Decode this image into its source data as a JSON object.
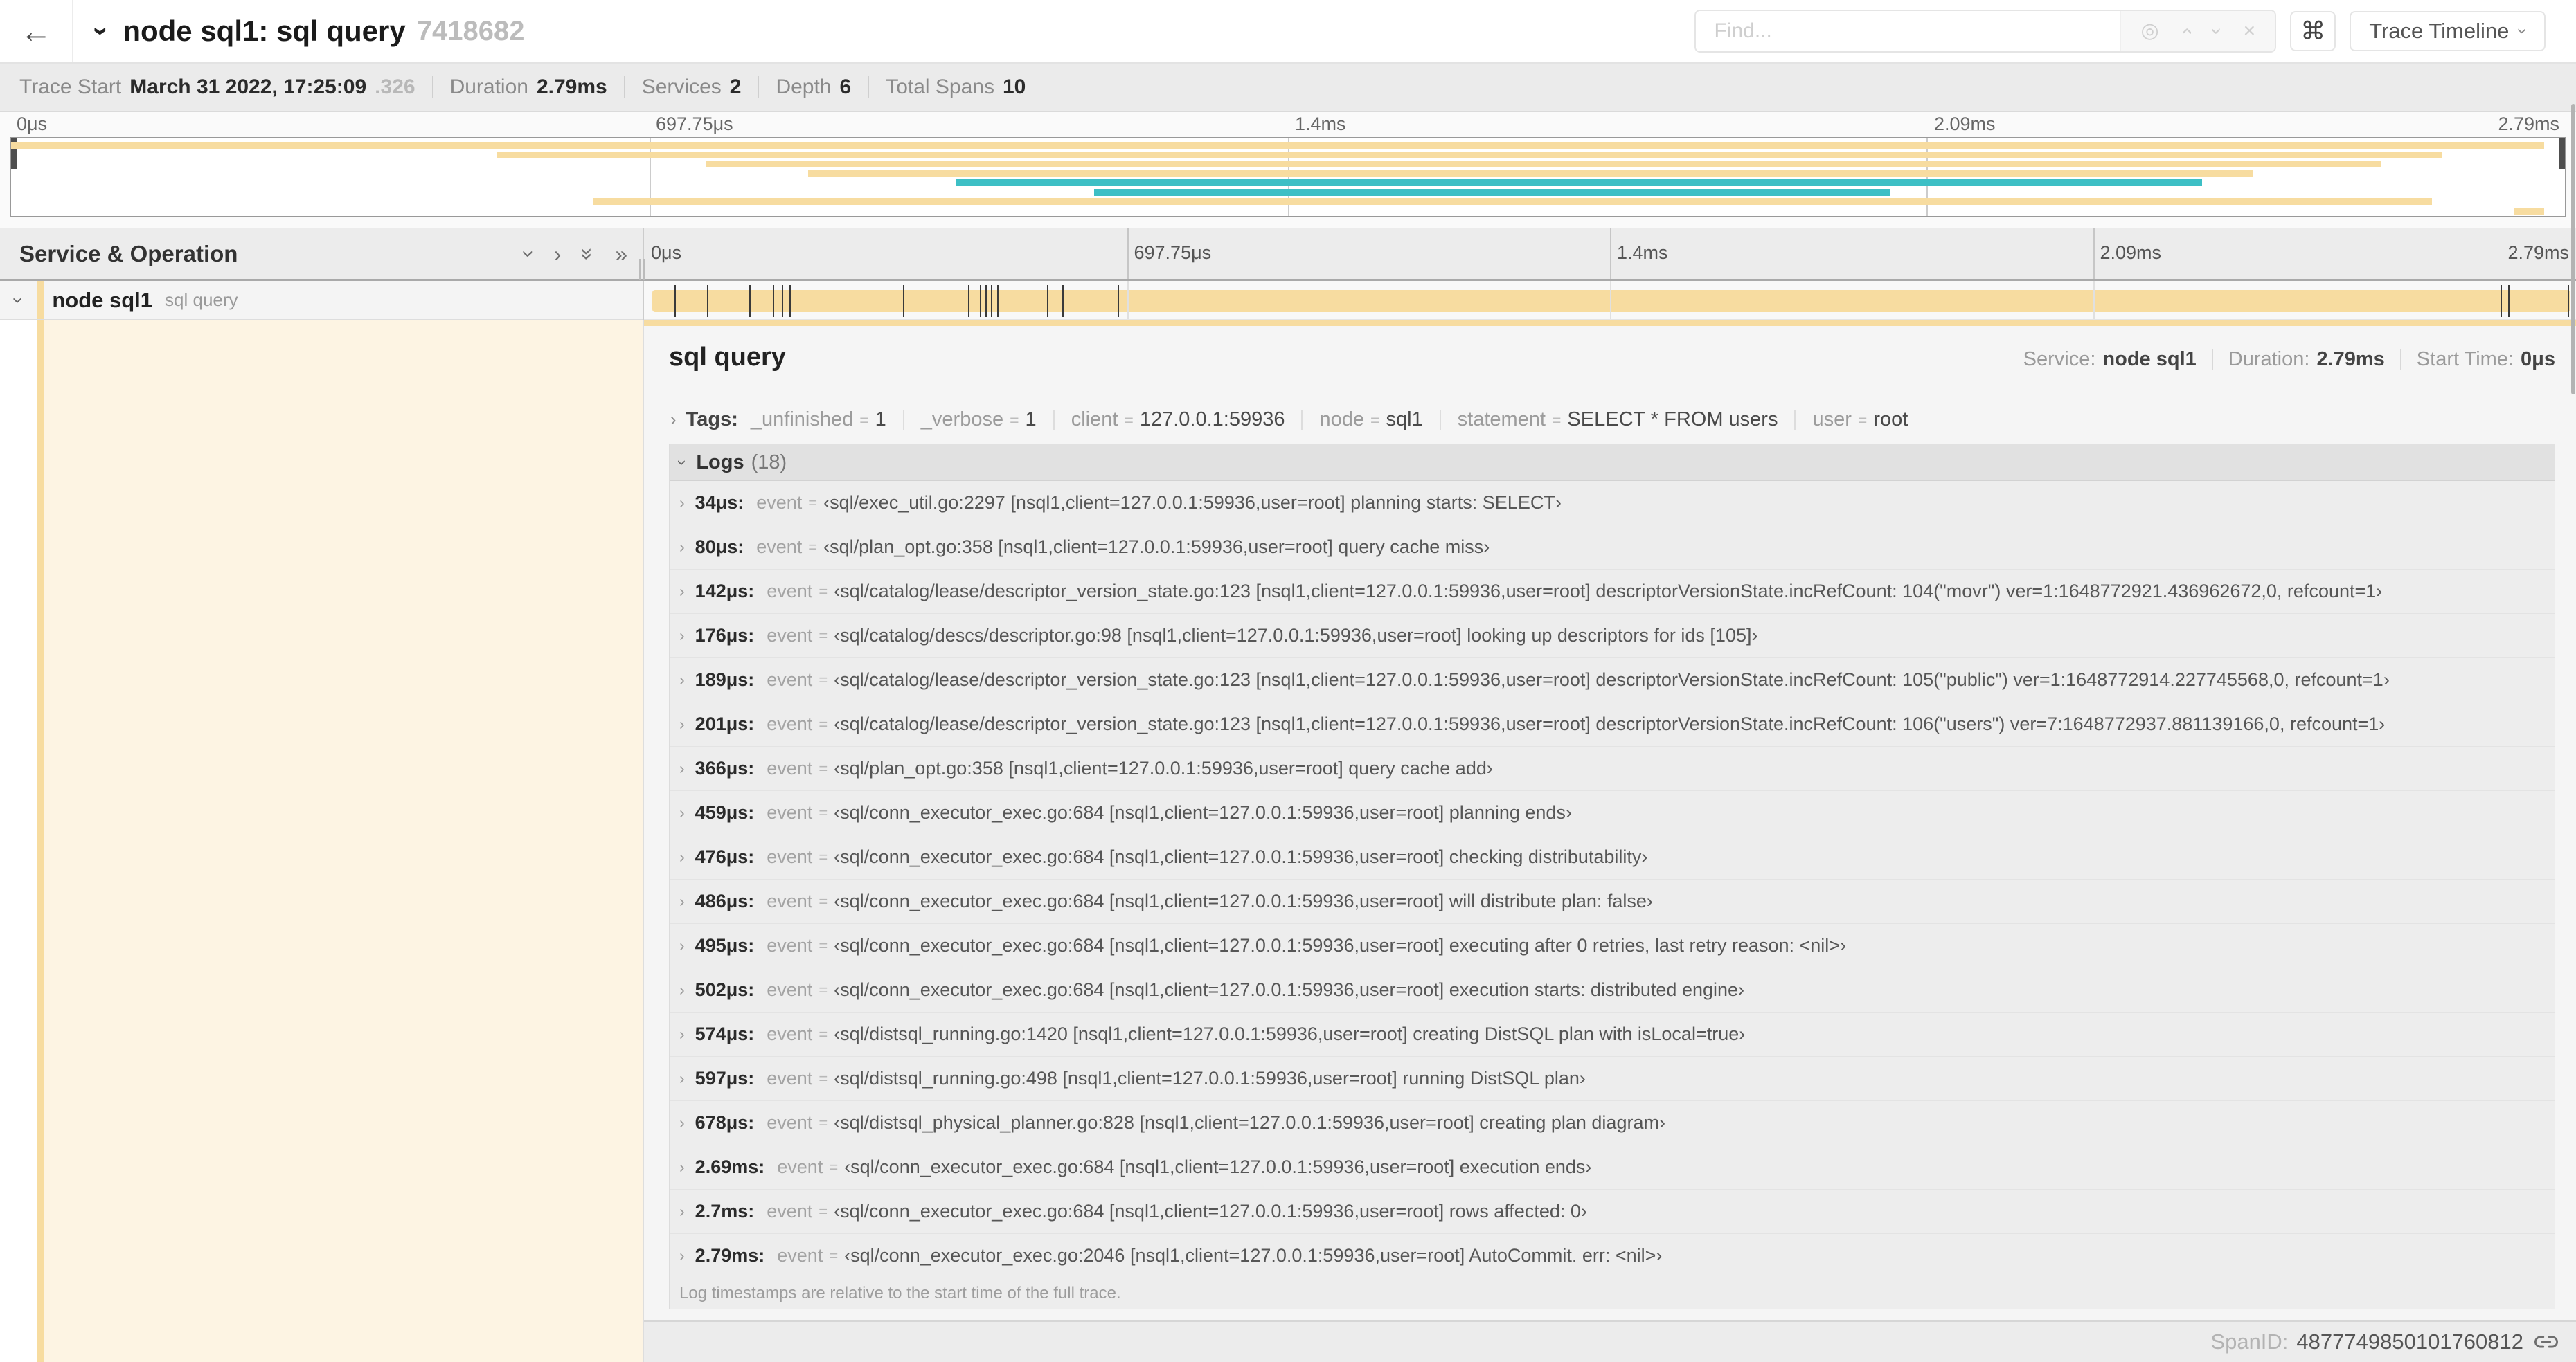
{
  "icons": {
    "back": "←",
    "chevron": "›",
    "double_chevron": "»",
    "target": "◎",
    "close": "×",
    "command": "⌘"
  },
  "header": {
    "title": "node sql1: sql query",
    "trace_id": "7418682",
    "find_placeholder": "Find...",
    "view_selector_label": "Trace Timeline"
  },
  "trace_meta": {
    "trace_start_label": "Trace Start",
    "trace_start_value": "March 31 2022, 17:25:09",
    "trace_start_fraction": ".326",
    "duration_label": "Duration",
    "duration_value": "2.79ms",
    "services_label": "Services",
    "services_value": "2",
    "depth_label": "Depth",
    "depth_value": "6",
    "total_spans_label": "Total Spans",
    "total_spans_value": "10"
  },
  "minimap": {
    "ticks": [
      "0μs",
      "697.75μs",
      "1.4ms",
      "2.09ms",
      "2.79ms"
    ],
    "colors": {
      "tan": "#F7DCA0",
      "teal": "#3DBFC5",
      "cream": "#FDF4E3"
    },
    "bars": [
      {
        "color": "tan",
        "row": 0,
        "start": 0.0,
        "end": 0.992
      },
      {
        "color": "tan",
        "row": 1,
        "start": 0.19,
        "end": 0.952
      },
      {
        "color": "tan",
        "row": 2,
        "start": 0.272,
        "end": 0.928
      },
      {
        "color": "tan",
        "row": 3,
        "start": 0.312,
        "end": 0.878
      },
      {
        "color": "teal",
        "row": 4,
        "start": 0.37,
        "end": 0.858
      },
      {
        "color": "teal",
        "row": 5,
        "start": 0.424,
        "end": 0.736
      },
      {
        "color": "tan",
        "row": 6,
        "start": 0.228,
        "end": 0.948
      },
      {
        "color": "tan",
        "row": 7,
        "start": 0.98,
        "end": 0.992
      }
    ]
  },
  "timeline": {
    "column_header": "Service & Operation",
    "ticks": [
      "0μs",
      "697.75μs",
      "1.4ms",
      "2.09ms",
      "2.79ms"
    ],
    "row": {
      "service": "node sql1",
      "operation": "sql query",
      "log_marks": [
        0.012,
        0.029,
        0.051,
        0.063,
        0.068,
        0.072,
        0.131,
        0.165,
        0.171,
        0.174,
        0.177,
        0.18,
        0.206,
        0.214,
        0.243,
        0.964,
        0.968,
        0.999
      ]
    }
  },
  "detail": {
    "title": "sql query",
    "service_label": "Service:",
    "service": "node sql1",
    "duration_label": "Duration:",
    "duration": "2.79ms",
    "start_time_label": "Start Time:",
    "start_time": "0μs",
    "tags": {
      "label": "Tags:",
      "items": [
        {
          "key": "_unfinished",
          "value": "1"
        },
        {
          "key": "_verbose",
          "value": "1"
        },
        {
          "key": "client",
          "value": "127.0.0.1:59936"
        },
        {
          "key": "node",
          "value": "sql1"
        },
        {
          "key": "statement",
          "value": "SELECT * FROM users"
        },
        {
          "key": "user",
          "value": "root"
        }
      ]
    },
    "logs": {
      "label": "Logs",
      "count": "(18)",
      "entries": [
        {
          "time": "34μs:",
          "key": "event",
          "value": "‹sql/exec_util.go:2297 [nsql1,client=127.0.0.1:59936,user=root] planning starts: SELECT›"
        },
        {
          "time": "80μs:",
          "key": "event",
          "value": "‹sql/plan_opt.go:358 [nsql1,client=127.0.0.1:59936,user=root] query cache miss›"
        },
        {
          "time": "142μs:",
          "key": "event",
          "value": "‹sql/catalog/lease/descriptor_version_state.go:123 [nsql1,client=127.0.0.1:59936,user=root] descriptorVersionState.incRefCount: 104(\"movr\") ver=1:1648772921.436962672,0, refcount=1›"
        },
        {
          "time": "176μs:",
          "key": "event",
          "value": "‹sql/catalog/descs/descriptor.go:98 [nsql1,client=127.0.0.1:59936,user=root] looking up descriptors for ids [105]›"
        },
        {
          "time": "189μs:",
          "key": "event",
          "value": "‹sql/catalog/lease/descriptor_version_state.go:123 [nsql1,client=127.0.0.1:59936,user=root] descriptorVersionState.incRefCount: 105(\"public\") ver=1:1648772914.227745568,0, refcount=1›"
        },
        {
          "time": "201μs:",
          "key": "event",
          "value": "‹sql/catalog/lease/descriptor_version_state.go:123 [nsql1,client=127.0.0.1:59936,user=root] descriptorVersionState.incRefCount: 106(\"users\") ver=7:1648772937.881139166,0, refcount=1›"
        },
        {
          "time": "366μs:",
          "key": "event",
          "value": "‹sql/plan_opt.go:358 [nsql1,client=127.0.0.1:59936,user=root] query cache add›"
        },
        {
          "time": "459μs:",
          "key": "event",
          "value": "‹sql/conn_executor_exec.go:684 [nsql1,client=127.0.0.1:59936,user=root] planning ends›"
        },
        {
          "time": "476μs:",
          "key": "event",
          "value": "‹sql/conn_executor_exec.go:684 [nsql1,client=127.0.0.1:59936,user=root] checking distributability›"
        },
        {
          "time": "486μs:",
          "key": "event",
          "value": "‹sql/conn_executor_exec.go:684 [nsql1,client=127.0.0.1:59936,user=root] will distribute plan: false›"
        },
        {
          "time": "495μs:",
          "key": "event",
          "value": "‹sql/conn_executor_exec.go:684 [nsql1,client=127.0.0.1:59936,user=root] executing after 0 retries, last retry reason: <nil>›"
        },
        {
          "time": "502μs:",
          "key": "event",
          "value": "‹sql/conn_executor_exec.go:684 [nsql1,client=127.0.0.1:59936,user=root] execution starts: distributed engine›"
        },
        {
          "time": "574μs:",
          "key": "event",
          "value": "‹sql/distsql_running.go:1420 [nsql1,client=127.0.0.1:59936,user=root] creating DistSQL plan with isLocal=true›"
        },
        {
          "time": "597μs:",
          "key": "event",
          "value": "‹sql/distsql_running.go:498 [nsql1,client=127.0.0.1:59936,user=root] running DistSQL plan›"
        },
        {
          "time": "678μs:",
          "key": "event",
          "value": "‹sql/distsql_physical_planner.go:828 [nsql1,client=127.0.0.1:59936,user=root] creating plan diagram›"
        },
        {
          "time": "2.69ms:",
          "key": "event",
          "value": "‹sql/conn_executor_exec.go:684 [nsql1,client=127.0.0.1:59936,user=root] execution ends›"
        },
        {
          "time": "2.7ms:",
          "key": "event",
          "value": "‹sql/conn_executor_exec.go:684 [nsql1,client=127.0.0.1:59936,user=root] rows affected: 0›"
        },
        {
          "time": "2.79ms:",
          "key": "event",
          "value": "‹sql/conn_executor_exec.go:2046 [nsql1,client=127.0.0.1:59936,user=root] AutoCommit. err: <nil>›"
        }
      ],
      "note": "Log timestamps are relative to the start time of the full trace."
    },
    "footer": {
      "span_id_label": "SpanID:",
      "span_id": "4877749850101760812"
    }
  }
}
